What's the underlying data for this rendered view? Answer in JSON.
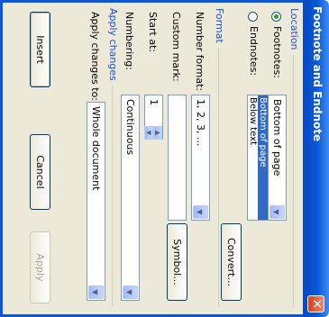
{
  "window": {
    "title": "Footnote and Endnote",
    "close_icon": "close-icon"
  },
  "location": {
    "group_label": "Location",
    "footnotes_label": "Footnotes:",
    "endnotes_label": "Endnotes:",
    "footnotes_selected": true,
    "footnotes_value": "Bottom of page",
    "list_options": [
      "Bottom of page",
      "Below text"
    ],
    "list_selected": "Bottom of page",
    "convert_label": "Convert..."
  },
  "format": {
    "group_label": "Format",
    "number_format_label": "Number format:",
    "number_format_value": "1, 2, 3, ...",
    "custom_mark_label": "Custom mark:",
    "custom_mark_value": "",
    "symbol_label": "Symbol...",
    "start_at_label": "Start at:",
    "start_at_value": "1",
    "numbering_label": "Numbering:",
    "numbering_value": "Continuous"
  },
  "apply_changes": {
    "group_label": "Apply changes",
    "apply_to_label": "Apply changes to:",
    "apply_to_value": "Whole document"
  },
  "buttons": {
    "insert": "Insert",
    "cancel": "Cancel",
    "apply": "Apply"
  }
}
